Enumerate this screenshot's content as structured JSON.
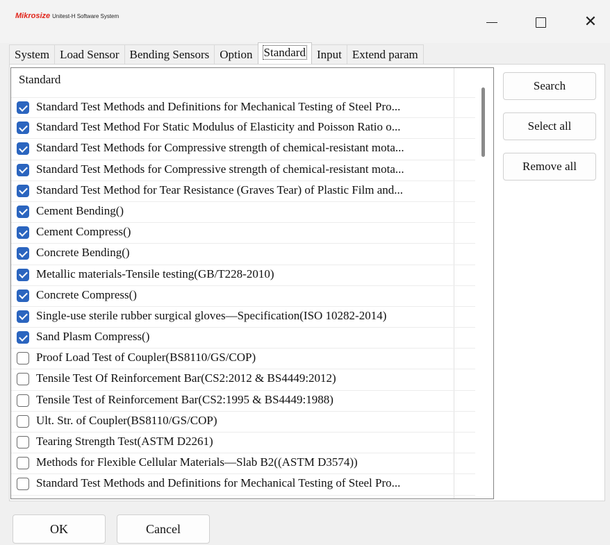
{
  "window": {
    "brand": "Mikrosize",
    "title": "Unitest-H Software System",
    "minimize_icon": "minimize-icon",
    "maximize_icon": "maximize-icon",
    "close_icon": "close-icon"
  },
  "tabs": [
    {
      "label": "System"
    },
    {
      "label": "Load Sensor"
    },
    {
      "label": "Bending Sensors"
    },
    {
      "label": "Option"
    },
    {
      "label": "Standard",
      "active": true
    },
    {
      "label": "Input"
    },
    {
      "label": "Extend param"
    }
  ],
  "list": {
    "header": "Standard",
    "items": [
      {
        "label": "Standard Test Methods and Definitions for Mechanical Testing of Steel Pro...",
        "checked": true
      },
      {
        "label": "Standard Test Method For Static Modulus of Elasticity and Poisson Ratio o...",
        "checked": true
      },
      {
        "label": "Standard Test Methods for Compressive strength of chemical-resistant mota...",
        "checked": true
      },
      {
        "label": "Standard Test Methods for Compressive strength of chemical-resistant mota...",
        "checked": true
      },
      {
        "label": "Standard Test Method for Tear Resistance (Graves Tear) of Plastic Film and...",
        "checked": true
      },
      {
        "label": "Cement Bending()",
        "checked": true
      },
      {
        "label": "Cement Compress()",
        "checked": true
      },
      {
        "label": "Concrete Bending()",
        "checked": true
      },
      {
        "label": "Metallic materials-Tensile testing(GB/T228-2010)",
        "checked": true
      },
      {
        "label": "Concrete Compress()",
        "checked": true
      },
      {
        "label": "Single-use sterile rubber surgical gloves—Specification(ISO 10282-2014)",
        "checked": true
      },
      {
        "label": "Sand Plasm Compress()",
        "checked": true
      },
      {
        "label": "Proof Load Test of Coupler(BS8110/GS/COP)",
        "checked": false
      },
      {
        "label": "Tensile Test Of Reinforcement Bar(CS2:2012 & BS4449:2012)",
        "checked": false
      },
      {
        "label": "Tensile Test of Reinforcement Bar(CS2:1995 & BS4449:1988)",
        "checked": false
      },
      {
        "label": "Ult. Str. of Coupler(BS8110/GS/COP)",
        "checked": false
      },
      {
        "label": "Tearing Strength Test(ASTM D2261)",
        "checked": false
      },
      {
        "label": "Methods for Flexible Cellular Materials—Slab B2((ASTM D3574))",
        "checked": false
      },
      {
        "label": "Standard Test Methods and Definitions for Mechanical Testing of Steel Pro...",
        "checked": false
      }
    ]
  },
  "side_buttons": {
    "search": "Search",
    "select_all": "Select all",
    "remove_all": "Remove all"
  },
  "footer": {
    "ok": "OK",
    "cancel": "Cancel"
  },
  "colors": {
    "brand": "#e1251b",
    "checkbox_checked": "#2b65bf"
  }
}
